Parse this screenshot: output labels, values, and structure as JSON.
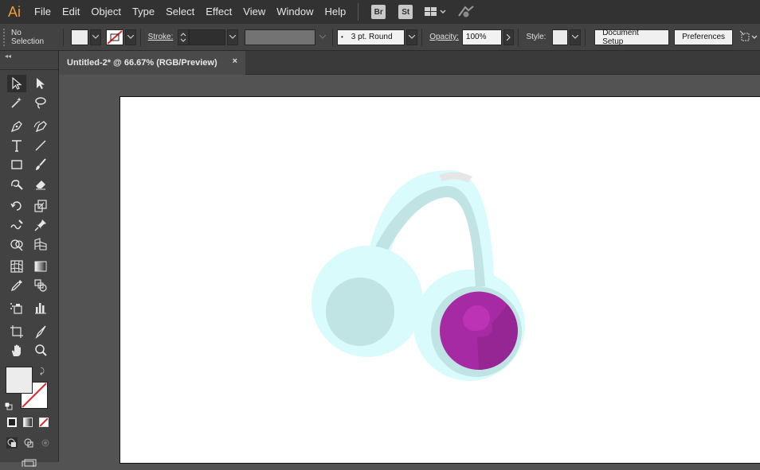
{
  "app": {
    "logo": "Ai"
  },
  "menu": {
    "items": [
      "File",
      "Edit",
      "Object",
      "Type",
      "Select",
      "Effect",
      "View",
      "Window",
      "Help"
    ]
  },
  "menubar_icons": {
    "bridge": "Br",
    "stock": "St",
    "workspace": "workspace-switcher-icon",
    "gpu": "gpu-performance-icon"
  },
  "controlbar": {
    "selection_label": "No Selection",
    "stroke_label": "Stroke:",
    "brush_value": "3 pt. Round",
    "opacity_label": "Opacity:",
    "opacity_value": "100%",
    "style_label": "Style:",
    "document_setup": "Document Setup",
    "preferences": "Preferences"
  },
  "document": {
    "tab_title": "Untitled-2* @ 66.67% (RGB/Preview)",
    "close_glyph": "×"
  },
  "tools": [
    "selection-tool",
    "direct-selection-tool",
    "magic-wand-tool",
    "lasso-tool",
    "pen-tool",
    "curvature-tool",
    "type-tool",
    "line-segment-tool",
    "rectangle-tool",
    "paintbrush-tool",
    "shaper-tool",
    "eraser-tool",
    "rotate-tool",
    "scale-tool",
    "warp-tool",
    "free-transform-tool",
    "shape-builder-tool",
    "perspective-grid-tool",
    "mesh-tool",
    "gradient-tool",
    "eyedropper-tool",
    "blend-tool",
    "symbol-sprayer-tool",
    "column-graph-tool",
    "artboard-tool",
    "slice-tool",
    "hand-tool",
    "zoom-tool"
  ],
  "colors": {
    "ear_outer": "#d9fbfb",
    "ear_inner": "#bfe4e3",
    "band": "#bfe4e3",
    "cap": "#e6e6e6",
    "magenta_main": "#a72aa5",
    "magenta_dark": "#962693",
    "magenta_light": "#bc33b6"
  }
}
